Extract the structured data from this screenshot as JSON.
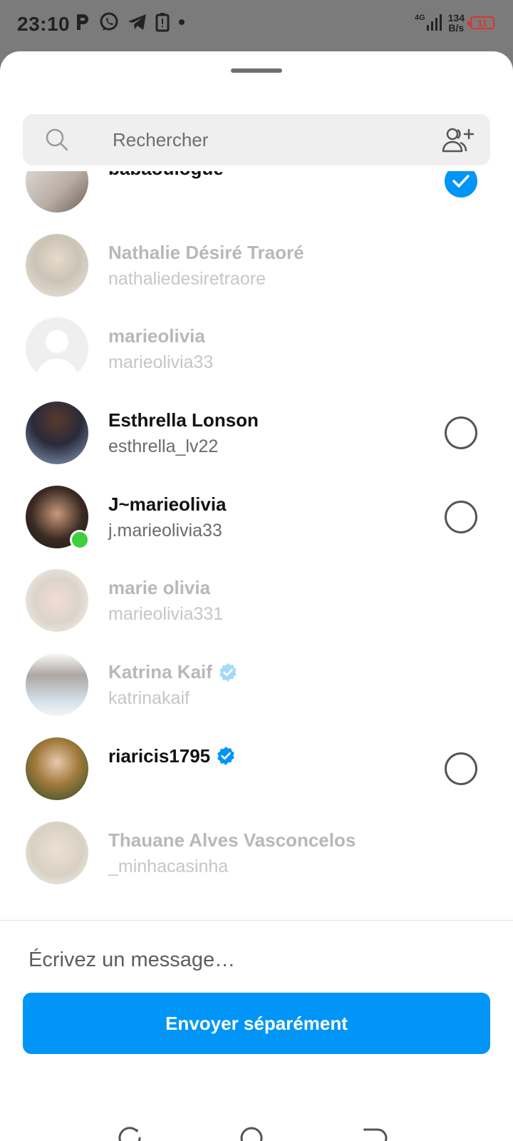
{
  "status_bar": {
    "time": "23:10",
    "network": "4G",
    "speed_value": "134",
    "speed_unit": "B/s",
    "battery": "11",
    "left_icons": [
      "p-icon",
      "whatsapp-icon",
      "telegram-icon",
      "battery-saver-icon",
      "dot-icon"
    ]
  },
  "search": {
    "placeholder": "Rechercher"
  },
  "contacts": [
    {
      "name": "babaoulogue",
      "username": "",
      "state": "selected",
      "verified": false
    },
    {
      "name": "Nathalie Désiré Traoré",
      "username": "nathaliedesiretraore",
      "state": "disabled",
      "verified": false
    },
    {
      "name": "marieolivia",
      "username": "marieolivia33",
      "state": "disabled",
      "verified": false
    },
    {
      "name": "Esthrella Lonson",
      "username": "esthrella_lv22",
      "state": "unselected",
      "verified": false
    },
    {
      "name": "J~marieolivia",
      "username": "j.marieolivia33",
      "state": "unselected",
      "verified": false,
      "online": true
    },
    {
      "name": "marie olivia",
      "username": "marieolivia331",
      "state": "disabled",
      "verified": false
    },
    {
      "name": "Katrina Kaif",
      "username": "katrinakaif",
      "state": "disabled",
      "verified": true
    },
    {
      "name": "riaricis1795",
      "username": "",
      "state": "unselected",
      "verified": true
    },
    {
      "name": "Thauane Alves Vasconcelos",
      "username": "_minhacasinha",
      "state": "disabled",
      "verified": false
    }
  ],
  "composer": {
    "placeholder": "Écrivez un message…",
    "send_label": "Envoyer séparément"
  },
  "colors": {
    "accent": "#0095f6",
    "online": "#3ecf3e",
    "battery_low": "#e0322d"
  }
}
